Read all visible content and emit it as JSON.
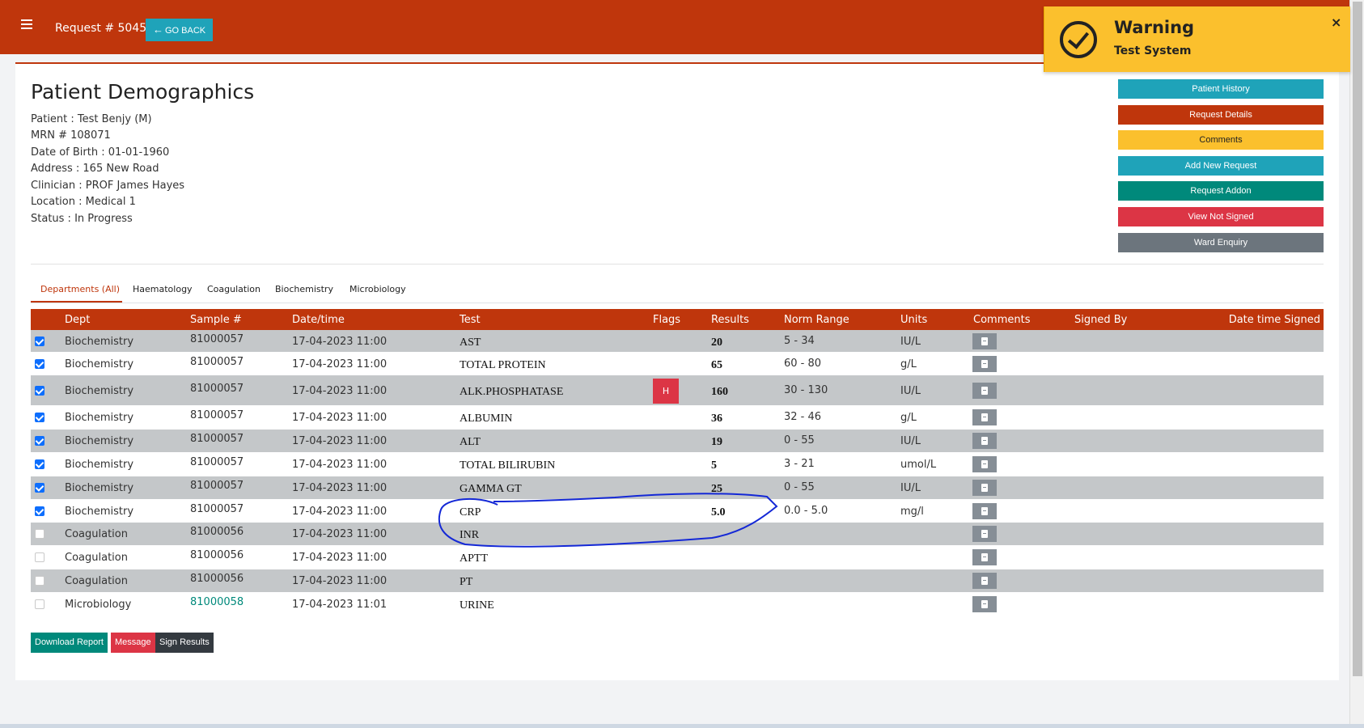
{
  "header": {
    "request_title": "Request # 50457",
    "go_back_label": "GO BACK"
  },
  "notification": {
    "title": "Warning",
    "message": "Test System",
    "close_label": "×"
  },
  "demographics": {
    "title": "Patient Demographics",
    "lines": [
      "Patient : Test Benjy (M)",
      "MRN # 108071",
      "Date of Birth : 01-01-1960",
      "Address : 165 New Road",
      "Clinician : PROF James Hayes",
      "Location : Medical 1",
      "Status : In Progress"
    ]
  },
  "actions": [
    {
      "label": "Patient History",
      "color": "#1fa3b9"
    },
    {
      "label": "Request Details",
      "color": "#bf360c"
    },
    {
      "label": "Comments",
      "color": "#fbc02d"
    },
    {
      "label": "Add New Request",
      "color": "#1fa3b9"
    },
    {
      "label": "Request Addon",
      "color": "#00897b"
    },
    {
      "label": "View Not Signed",
      "color": "#dc3545"
    },
    {
      "label": "Ward Enquiry",
      "color": "#6c757d"
    }
  ],
  "tabs": [
    "Departments (All)",
    "Haematology",
    "Coagulation",
    "Biochemistry",
    "Microbiology"
  ],
  "table": {
    "headers": [
      "Dept",
      "Sample #",
      "Date/time",
      "Test",
      "Flags",
      "Results",
      "Norm Range",
      "Units",
      "Comments",
      "Signed By",
      "Date time Signed"
    ],
    "rows": [
      {
        "checked": true,
        "dept": "Biochemistry",
        "sample": "81000057",
        "datetime": "17-04-2023 11:00",
        "test": "AST",
        "flag": "",
        "result": "20",
        "range": "5 - 34",
        "units": "IU/L"
      },
      {
        "checked": true,
        "dept": "Biochemistry",
        "sample": "81000057",
        "datetime": "17-04-2023 11:00",
        "test": "TOTAL PROTEIN",
        "flag": "",
        "result": "65",
        "range": "60 - 80",
        "units": "g/L"
      },
      {
        "checked": true,
        "dept": "Biochemistry",
        "sample": "81000057",
        "datetime": "17-04-2023 11:00",
        "test": "ALK.PHOSPHATASE",
        "flag": "H",
        "result": "160",
        "range": "30 - 130",
        "units": "IU/L"
      },
      {
        "checked": true,
        "dept": "Biochemistry",
        "sample": "81000057",
        "datetime": "17-04-2023 11:00",
        "test": "ALBUMIN",
        "flag": "",
        "result": "36",
        "range": "32 - 46",
        "units": "g/L"
      },
      {
        "checked": true,
        "dept": "Biochemistry",
        "sample": "81000057",
        "datetime": "17-04-2023 11:00",
        "test": "ALT",
        "flag": "",
        "result": "19",
        "range": "0 - 55",
        "units": "IU/L"
      },
      {
        "checked": true,
        "dept": "Biochemistry",
        "sample": "81000057",
        "datetime": "17-04-2023 11:00",
        "test": "TOTAL BILIRUBIN",
        "flag": "",
        "result": "5",
        "range": "3 - 21",
        "units": "umol/L"
      },
      {
        "checked": true,
        "dept": "Biochemistry",
        "sample": "81000057",
        "datetime": "17-04-2023 11:00",
        "test": "GAMMA GT",
        "flag": "",
        "result": "25",
        "range": "0 - 55",
        "units": "IU/L"
      },
      {
        "checked": true,
        "dept": "Biochemistry",
        "sample": "81000057",
        "datetime": "17-04-2023 11:00",
        "test": "CRP",
        "flag": "",
        "result": "5.0",
        "range": "0.0 - 5.0",
        "units": "mg/l"
      },
      {
        "checked": false,
        "dept": "Coagulation",
        "sample": "81000056",
        "datetime": "17-04-2023 11:00",
        "test": "INR",
        "flag": "",
        "result": "",
        "range": "",
        "units": ""
      },
      {
        "checked": false,
        "dept": "Coagulation",
        "sample": "81000056",
        "datetime": "17-04-2023 11:00",
        "test": "APTT",
        "flag": "",
        "result": "",
        "range": "",
        "units": ""
      },
      {
        "checked": false,
        "dept": "Coagulation",
        "sample": "81000056",
        "datetime": "17-04-2023 11:00",
        "test": "PT",
        "flag": "",
        "result": "",
        "range": "",
        "units": ""
      },
      {
        "checked": false,
        "dept": "Microbiology",
        "sample": "81000058",
        "datetime": "17-04-2023 11:01",
        "test": "URINE",
        "flag": "",
        "result": "",
        "range": "",
        "units": ""
      }
    ]
  },
  "footer_actions": [
    {
      "label": "Download Report",
      "color": "#00897b"
    },
    {
      "label": "Message",
      "color": "#dc3545"
    },
    {
      "label": "Sign Results",
      "color": "#343a40"
    }
  ]
}
